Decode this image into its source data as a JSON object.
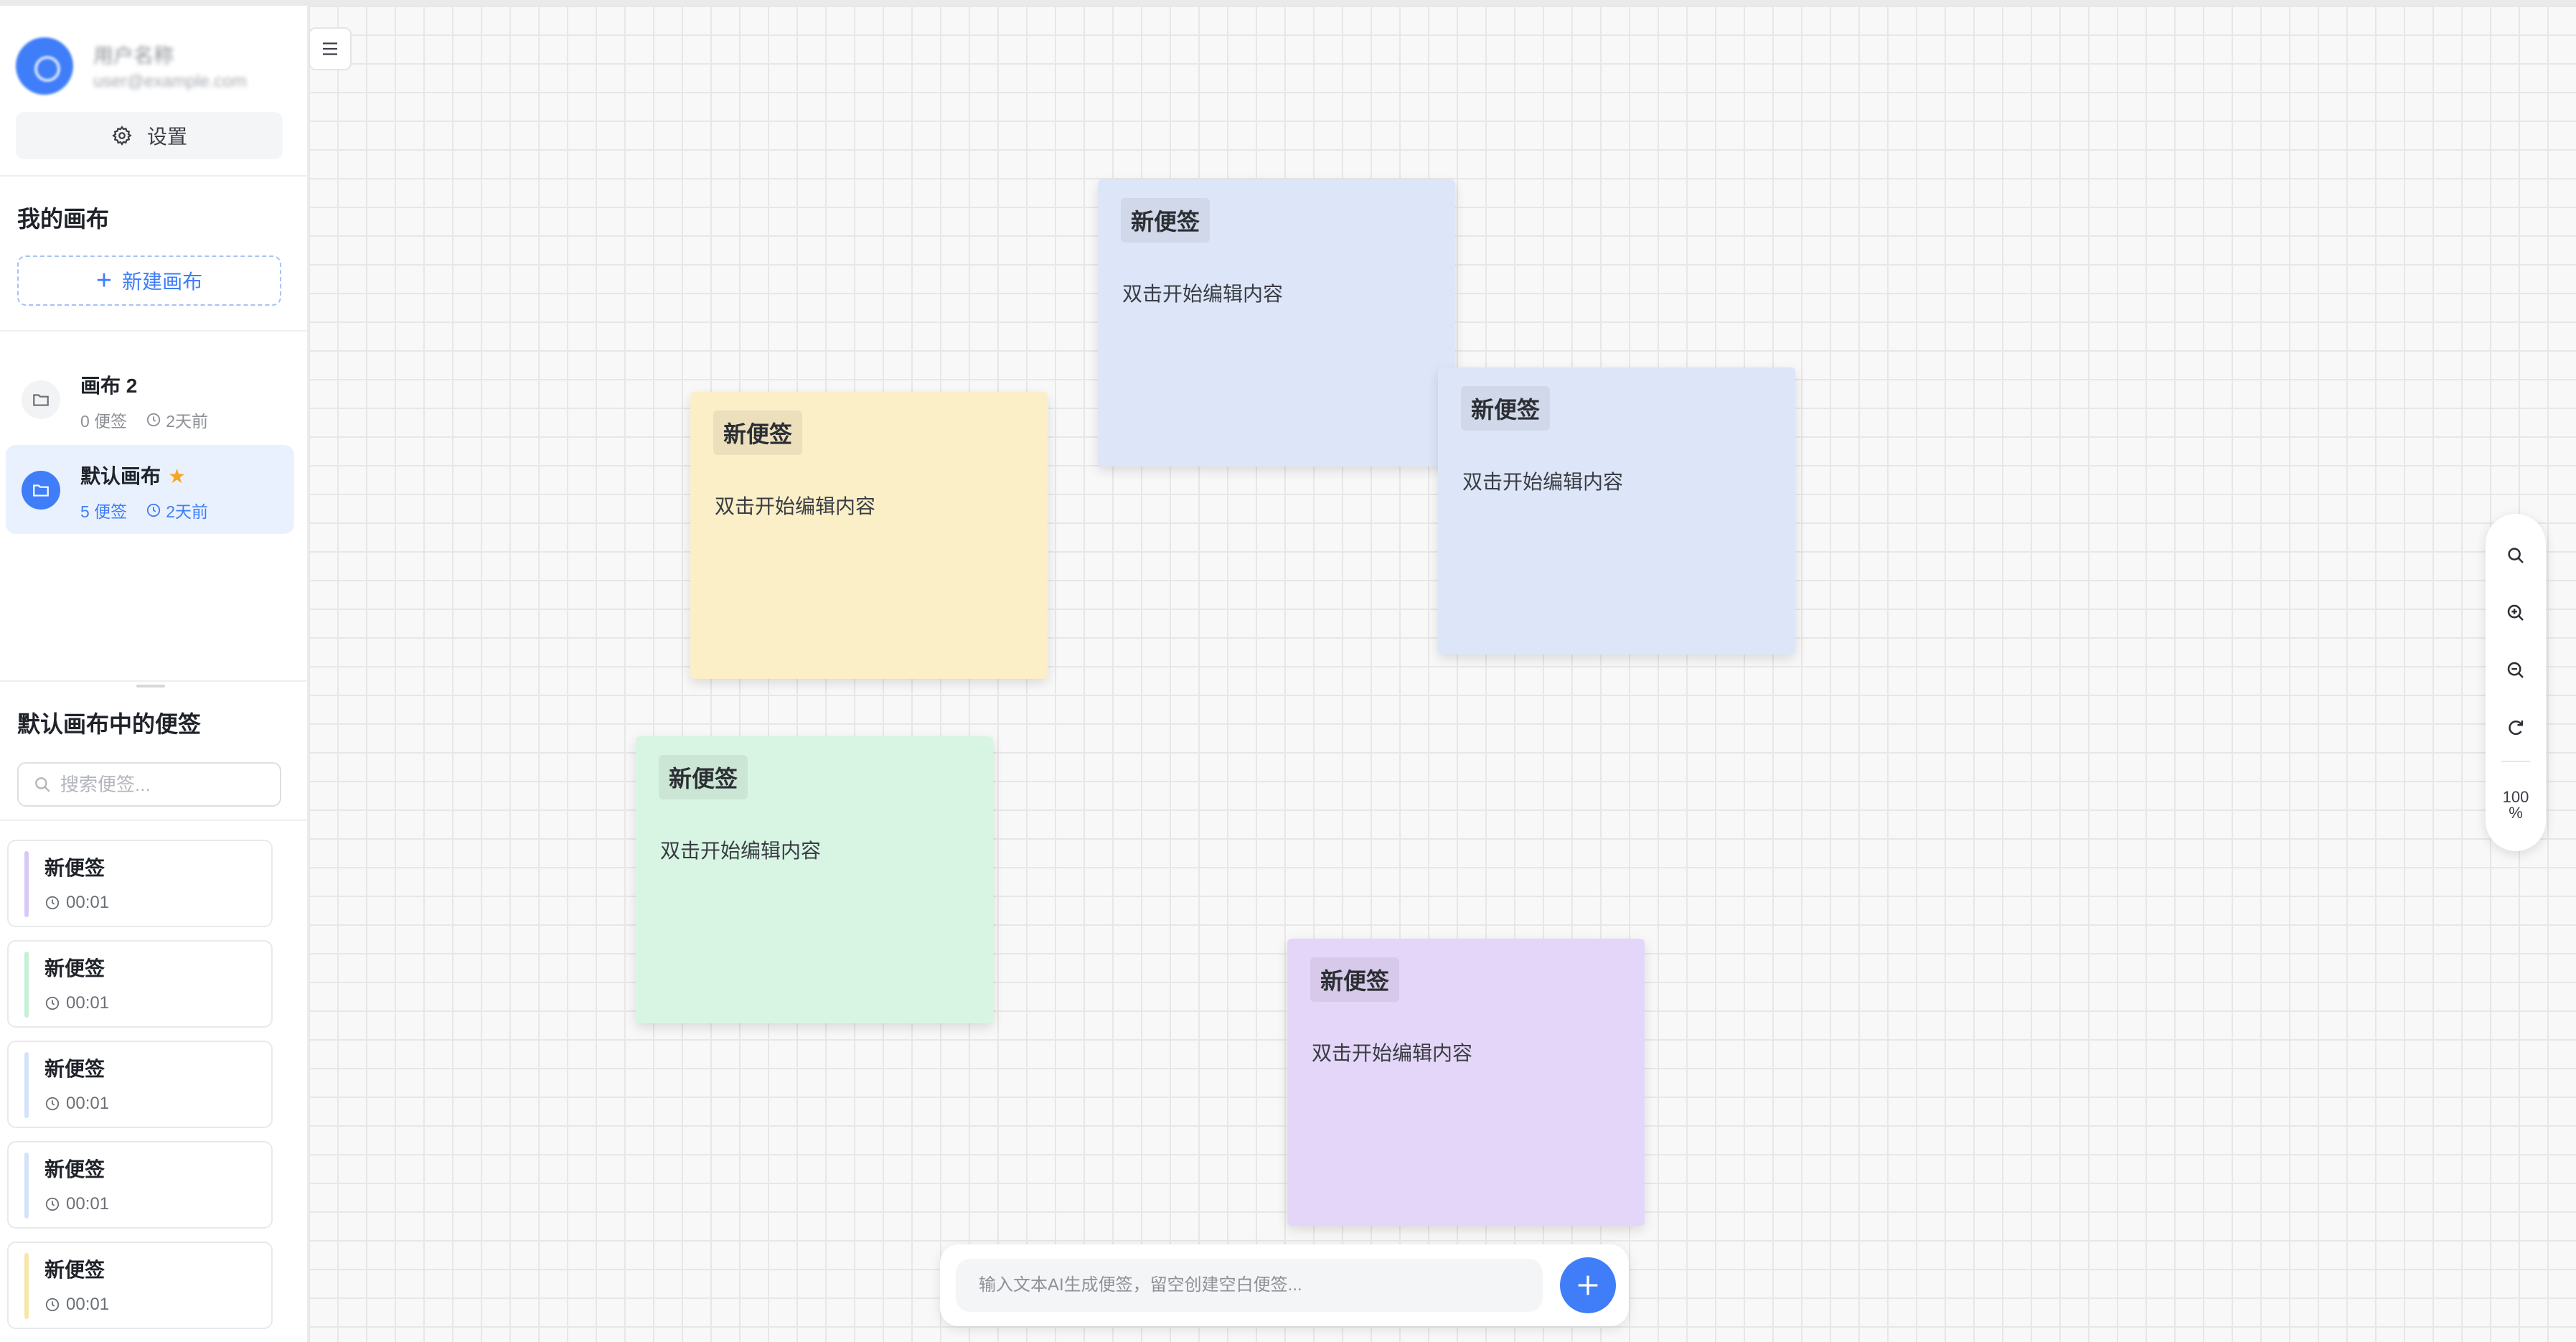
{
  "user": {
    "name": "用户名称",
    "email": "user@example.com"
  },
  "sidebar": {
    "settings_label": "设置",
    "my_canvases_title": "我的画布",
    "new_canvas_label": "新建画布",
    "canvases": [
      {
        "name": "画布 2",
        "starred": false,
        "count": "0 便签",
        "time": "2天前"
      },
      {
        "name": "默认画布",
        "starred": true,
        "star": "★",
        "count": "5 便签",
        "time": "2天前"
      }
    ],
    "notes_title": "默认画布中的便签",
    "search_placeholder": "搜索便签...",
    "notes": [
      {
        "title": "新便签",
        "time": "00:01",
        "color": "#d9c8f5"
      },
      {
        "title": "新便签",
        "time": "00:01",
        "color": "#c6f0d6"
      },
      {
        "title": "新便签",
        "time": "00:01",
        "color": "#d5e2fa"
      },
      {
        "title": "新便签",
        "time": "00:01",
        "color": "#d5e2fa"
      },
      {
        "title": "新便签",
        "time": "00:01",
        "color": "#f8e6a9"
      }
    ]
  },
  "canvas": {
    "stickies": [
      {
        "title": "新便签",
        "body": "双击开始编辑内容",
        "color": "#dde6f8"
      },
      {
        "title": "新便签",
        "body": "双击开始编辑内容",
        "color": "#fbefc8"
      },
      {
        "title": "新便签",
        "body": "双击开始编辑内容",
        "color": "#dde6f8"
      },
      {
        "title": "新便签",
        "body": "双击开始编辑内容",
        "color": "#d8f5e3"
      },
      {
        "title": "新便签",
        "body": "双击开始编辑内容",
        "color": "#e4d6f8"
      }
    ],
    "zoom": {
      "value": 100,
      "label": "100",
      "unit": "%"
    },
    "ai_placeholder": "输入文本AI生成便签，留空创建空白便签..."
  },
  "colors": {
    "accent": "#3f7ef8",
    "star": "#f5a623"
  }
}
